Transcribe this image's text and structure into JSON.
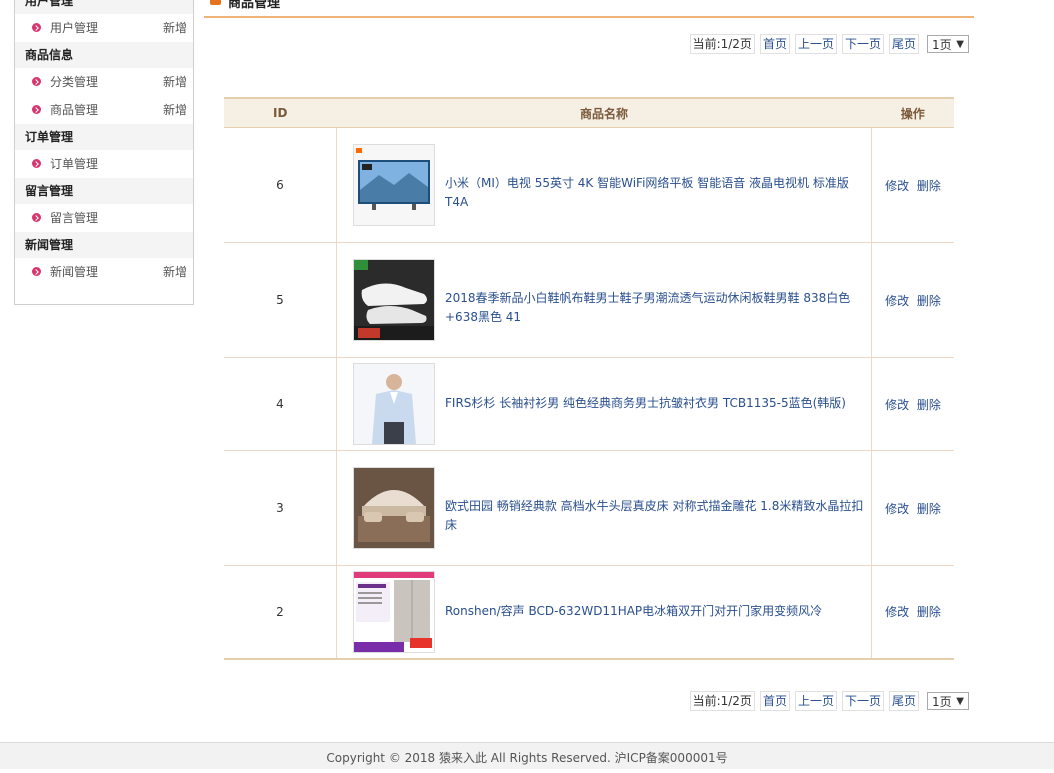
{
  "sidebar": {
    "sections": [
      {
        "title": "用户管理",
        "items": [
          {
            "label": "用户管理",
            "add": "新增"
          }
        ]
      },
      {
        "title": "商品信息",
        "items": [
          {
            "label": "分类管理",
            "add": "新增"
          },
          {
            "label": "商品管理",
            "add": "新增"
          }
        ]
      },
      {
        "title": "订单管理",
        "items": [
          {
            "label": "订单管理",
            "add": ""
          }
        ]
      },
      {
        "title": "留言管理",
        "items": [
          {
            "label": "留言管理",
            "add": ""
          }
        ]
      },
      {
        "title": "新闻管理",
        "items": [
          {
            "label": "新闻管理",
            "add": "新增"
          }
        ]
      }
    ]
  },
  "main": {
    "title": "商品管理",
    "pager": {
      "current": "当前:1/2页",
      "first": "首页",
      "prev": "上一页",
      "next": "下一页",
      "last": "尾页",
      "select_value": "1页"
    },
    "table": {
      "headers": {
        "id": "ID",
        "name": "商品名称",
        "ops": "操作"
      },
      "rows": [
        {
          "id": "6",
          "name": "小米（MI）电视 55英寸 4K 智能WiFi网络平板 智能语音 液晶电视机 标准版T4A",
          "edit": "修改",
          "del": "删除"
        },
        {
          "id": "5",
          "name": "2018春季新品小白鞋帆布鞋男士鞋子男潮流透气运动休闲板鞋男鞋 838白色+638黑色 41",
          "edit": "修改",
          "del": "删除"
        },
        {
          "id": "4",
          "name": "FIRS杉杉 长袖衬衫男 纯色经典商务男士抗皱衬衣男 TCB1135-5蓝色(韩版)",
          "edit": "修改",
          "del": "删除"
        },
        {
          "id": "3",
          "name": "欧式田园 畅销经典款 高档水牛头层真皮床 对称式描金雕花 1.8米精致水晶拉扣床",
          "edit": "修改",
          "del": "删除"
        },
        {
          "id": "2",
          "name": "Ronshen/容声 BCD-632WD11HAP电冰箱双开门对开门家用变频风冷",
          "edit": "修改",
          "del": "删除"
        }
      ]
    }
  },
  "footer": {
    "text": "Copyright © 2018 猿来入此 All Rights Reserved. 沪ICP备案000001号"
  },
  "colors": {
    "accent": "#f0b47a",
    "link": "#2a4f8f",
    "bullet": "#d8346e",
    "header_bg": "#f6efe4"
  }
}
